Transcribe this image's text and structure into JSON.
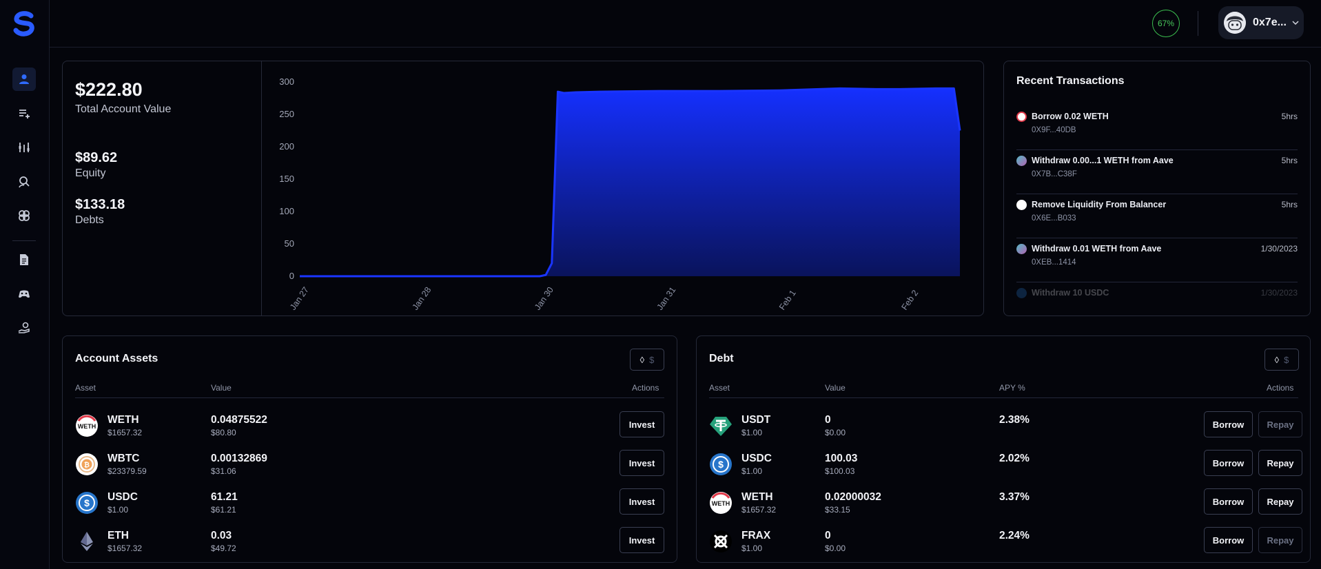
{
  "topbar": {
    "health_percent": "67%",
    "account_address": "0x7e..."
  },
  "sidebar": {
    "items": [
      {
        "icon": "user-icon",
        "active": true
      },
      {
        "icon": "add-list-icon",
        "active": false
      },
      {
        "icon": "chart-tools-icon",
        "active": false
      },
      {
        "icon": "search-user-icon",
        "active": false
      },
      {
        "icon": "link-rings-icon",
        "active": false
      },
      {
        "icon": "document-icon",
        "active": false
      },
      {
        "icon": "gamepad-icon",
        "active": false
      },
      {
        "icon": "hand-coin-icon",
        "active": false
      }
    ]
  },
  "summary": {
    "total_value": "$222.80",
    "total_label": "Total Account Value",
    "equity_value": "$89.62",
    "equity_label": "Equity",
    "debts_value": "$133.18",
    "debts_label": "Debts"
  },
  "chart_data": {
    "type": "area",
    "x_tick_labels": [
      "Jan 27",
      "Jan 28",
      "Jan 30",
      "Jan 31",
      "Feb 1",
      "Feb 2"
    ],
    "y_tick_labels": [
      "0",
      "50",
      "100",
      "150",
      "200",
      "250",
      "300"
    ],
    "ylim": [
      0,
      300
    ],
    "x": [
      0,
      0.5,
      1.0,
      1.5,
      2.0,
      2.05,
      2.1,
      2.15,
      2.2,
      2.3,
      2.5,
      3.0,
      3.5,
      4.0,
      4.5,
      4.8,
      5.0,
      5.3,
      5.45,
      5.5
    ],
    "values": [
      0,
      0,
      0,
      0,
      0,
      2,
      20,
      285,
      283,
      284,
      285,
      286,
      286,
      287,
      290,
      289,
      289,
      290,
      290,
      225
    ],
    "color": "#1a35ff",
    "grid": false,
    "legend": "none"
  },
  "transactions": {
    "title": "Recent Transactions",
    "items": [
      {
        "name": "Borrow 0.02 WETH",
        "hash": "0X9F...40DB",
        "time": "5hrs",
        "icon": "weth-icon",
        "color": "#ffffff"
      },
      {
        "name": "Withdraw 0.00...1 WETH from Aave",
        "hash": "0X7B...C38F",
        "time": "5hrs",
        "icon": "aave-icon",
        "color": "#7a5cc7"
      },
      {
        "name": "Remove Liquidity From Balancer",
        "hash": "0X6E...B033",
        "time": "5hrs",
        "icon": "balancer-icon",
        "color": "#ffffff"
      },
      {
        "name": "Withdraw 0.01 WETH from Aave",
        "hash": "0XEB...1414",
        "time": "1/30/2023",
        "icon": "aave-icon",
        "color": "#7a5cc7"
      },
      {
        "name": "Withdraw 10 USDC",
        "hash": "",
        "time": "1/30/2023",
        "icon": "usdc-icon",
        "color": "#2775ca"
      }
    ]
  },
  "assets": {
    "title": "Account Assets",
    "toggle_eth": "◊",
    "toggle_usd": "$",
    "headers": {
      "asset": "Asset",
      "value": "Value",
      "actions": "Actions"
    },
    "rows": [
      {
        "name": "WETH",
        "price": "$1657.32",
        "amount": "0.04875522",
        "usd": "$80.80",
        "action": "Invest"
      },
      {
        "name": "WBTC",
        "price": "$23379.59",
        "amount": "0.00132869",
        "usd": "$31.06",
        "action": "Invest"
      },
      {
        "name": "USDC",
        "price": "$1.00",
        "amount": "61.21",
        "usd": "$61.21",
        "action": "Invest"
      },
      {
        "name": "ETH",
        "price": "$1657.32",
        "amount": "0.03",
        "usd": "$49.72",
        "action": "Invest"
      }
    ]
  },
  "debt": {
    "title": "Debt",
    "toggle_eth": "◊",
    "toggle_usd": "$",
    "headers": {
      "asset": "Asset",
      "value": "Value",
      "apy": "APY %",
      "actions": "Actions"
    },
    "rows": [
      {
        "name": "USDT",
        "price": "$1.00",
        "amount": "0",
        "usd": "$0.00",
        "apy": "2.38%",
        "borrow": "Borrow",
        "repay": "Repay",
        "repay_enabled": false
      },
      {
        "name": "USDC",
        "price": "$1.00",
        "amount": "100.03",
        "usd": "$100.03",
        "apy": "2.02%",
        "borrow": "Borrow",
        "repay": "Repay",
        "repay_enabled": true
      },
      {
        "name": "WETH",
        "price": "$1657.32",
        "amount": "0.02000032",
        "usd": "$33.15",
        "apy": "3.37%",
        "borrow": "Borrow",
        "repay": "Repay",
        "repay_enabled": true
      },
      {
        "name": "FRAX",
        "price": "$1.00",
        "amount": "0",
        "usd": "$0.00",
        "apy": "2.24%",
        "borrow": "Borrow",
        "repay": "Repay",
        "repay_enabled": false
      }
    ]
  }
}
